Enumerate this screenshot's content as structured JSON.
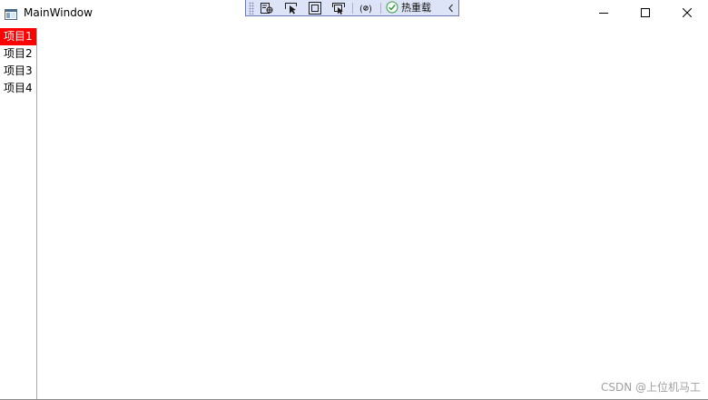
{
  "window": {
    "title": "MainWindow",
    "icons": {
      "app": "window-app-icon",
      "minimize": "minimize-icon",
      "maximize": "maximize-icon",
      "close": "close-icon"
    }
  },
  "runtime_toolbar": {
    "buttons": [
      {
        "name": "go-to-live-visual-tree",
        "icon": "live-visual-tree-icon"
      },
      {
        "name": "select-element",
        "icon": "select-element-icon"
      },
      {
        "name": "display-layout-adorners",
        "icon": "layout-adorner-icon"
      },
      {
        "name": "track-focused-element",
        "icon": "track-focus-icon"
      },
      {
        "name": "binding-failures",
        "icon": "binding-icon"
      }
    ],
    "hot_reload_label": "热重载",
    "hot_reload_icon": "check-circle-icon",
    "hot_reload_color": "#2e9e3f",
    "collapse_icon": "chevron-left-icon"
  },
  "sidebar": {
    "items": [
      {
        "label": "项目1",
        "selected": true
      },
      {
        "label": "项目2",
        "selected": false
      },
      {
        "label": "项目3",
        "selected": false
      },
      {
        "label": "项目4",
        "selected": false
      }
    ],
    "selected_color": "#ff0000"
  },
  "watermark": "CSDN @上位机马工"
}
